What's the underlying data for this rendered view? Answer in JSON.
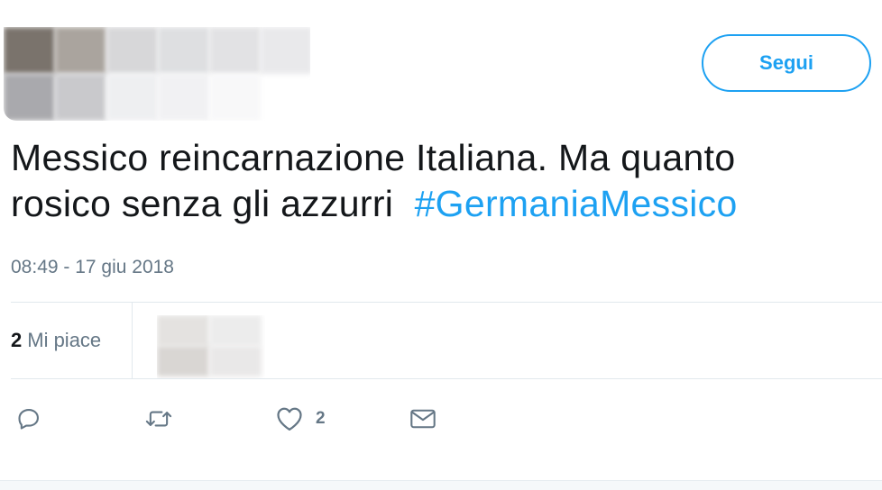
{
  "header": {
    "follow_label": "Segui"
  },
  "tweet": {
    "text_line1": "Messico reincarnazione Italiana. Ma quanto",
    "text_line2": "rosico senza gli azzurri",
    "hashtag": "#GermaniaMessico",
    "timestamp": "08:49 - 17 giu 2018"
  },
  "stats": {
    "likes_count": "2",
    "likes_label": "Mi piace"
  },
  "actions": {
    "reply_icon": "reply-icon",
    "retweet_icon": "retweet-icon",
    "like_icon": "heart-icon",
    "like_count": "2",
    "dm_icon": "envelope-icon"
  },
  "colors": {
    "accent": "#1da1f2",
    "secondary_text": "#657786",
    "divider": "#e1e8ed"
  }
}
